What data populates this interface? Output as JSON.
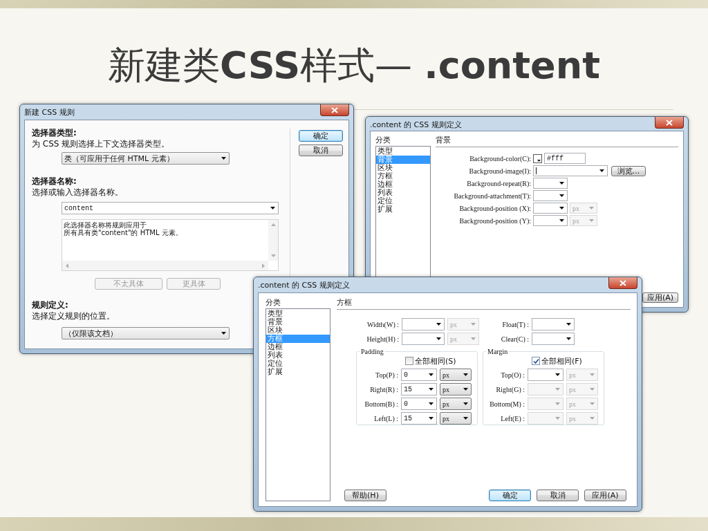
{
  "slide_title": "新建类**CSS**样式— **.content**",
  "new_rule_dialog": {
    "title": "新建 CSS 规则",
    "selector_type": {
      "heading": "选择器类型:",
      "description": "为 CSS 规则选择上下文选择器类型。",
      "value": "类（可应用于任何 HTML 元素）"
    },
    "selector_name": {
      "heading": "选择器名称:",
      "description": "选择或输入选择器名称。",
      "value": "content",
      "info": [
        "此选择器名称将规则应用于",
        "所有具有类\"content\"的 HTML 元素。"
      ]
    },
    "specificity_buttons": [
      {
        "label": "不太具体",
        "disabled": true
      },
      {
        "label": "更具体",
        "disabled": true
      }
    ],
    "rule_definition": {
      "heading": "规则定义:",
      "description": "选择定义规则的位置。",
      "value": "（仅限该文档）"
    },
    "buttons": [
      {
        "label": "确定",
        "focused": true
      },
      {
        "label": "取消",
        "focused": false
      }
    ]
  },
  "background_dialog": {
    "title": ".content 的 CSS 规则定义",
    "category_label": "分类",
    "categories": [
      {
        "label": "类型",
        "selected": false
      },
      {
        "label": "背景",
        "selected": true
      },
      {
        "label": "区块",
        "selected": false
      },
      {
        "label": "方框",
        "selected": false
      },
      {
        "label": "边框",
        "selected": false
      },
      {
        "label": "列表",
        "selected": false
      },
      {
        "label": "定位",
        "selected": false
      },
      {
        "label": "扩展",
        "selected": false
      }
    ],
    "section": "背景",
    "fields": [
      {
        "kind": "color",
        "label": "Background-color(C):",
        "value": "#fff"
      },
      {
        "kind": "image",
        "label": "Background-image(I):",
        "button": "浏览..."
      },
      {
        "kind": "select",
        "label": "Background-repeat(R):"
      },
      {
        "kind": "select",
        "label": "Background-attachment(T):"
      },
      {
        "kind": "select_unit",
        "label": "Background-position (X):",
        "unit": "px",
        "unit_disabled": true
      },
      {
        "kind": "select_unit",
        "label": "Background-position (Y):",
        "unit": "px",
        "unit_disabled": true
      }
    ],
    "apply_button": "应用(A)"
  },
  "box_dialog": {
    "title": ".content 的 CSS 规则定义",
    "category_label": "分类",
    "categories": [
      {
        "label": "类型",
        "selected": false
      },
      {
        "label": "背景",
        "selected": false
      },
      {
        "label": "区块",
        "selected": false
      },
      {
        "label": "方框",
        "selected": true
      },
      {
        "label": "边框",
        "selected": false
      },
      {
        "label": "列表",
        "selected": false
      },
      {
        "label": "定位",
        "selected": false
      },
      {
        "label": "扩展",
        "selected": false
      }
    ],
    "section": "方框",
    "size_fields": [
      {
        "label": "Width(W) :",
        "unit": "px",
        "unit_disabled": true
      },
      {
        "label": "Height(H) :",
        "unit": "px",
        "unit_disabled": true
      }
    ],
    "layout_fields": [
      {
        "label": "Float(T) :"
      },
      {
        "label": "Clear(C) :"
      }
    ],
    "groups": [
      {
        "legend": "Padding",
        "same_all": {
          "label": "全部相同(S)",
          "checked": false
        },
        "rows": [
          {
            "label": "Top(P) :",
            "value": "0",
            "unit": "px",
            "disabled": false,
            "unit_disabled": false
          },
          {
            "label": "Right(R) :",
            "value": "15",
            "unit": "px",
            "disabled": false,
            "unit_disabled": false
          },
          {
            "label": "Bottom(B) :",
            "value": "0",
            "unit": "px",
            "disabled": false,
            "unit_disabled": false
          },
          {
            "label": "Left(L) :",
            "value": "15",
            "unit": "px",
            "disabled": false,
            "unit_disabled": false
          }
        ]
      },
      {
        "legend": "Margin",
        "same_all": {
          "label": "全部相同(F)",
          "checked": true
        },
        "rows": [
          {
            "label": "Top(O) :",
            "unit": "px",
            "disabled": false,
            "unit_disabled": true
          },
          {
            "label": "Right(G) :",
            "unit": "px",
            "disabled": true,
            "unit_disabled": true
          },
          {
            "label": "Bottom(M) :",
            "unit": "px",
            "disabled": true,
            "unit_disabled": true
          },
          {
            "label": "Left(E) :",
            "unit": "px",
            "disabled": true,
            "unit_disabled": true
          }
        ]
      }
    ],
    "help_button": "帮助(H)",
    "buttons": [
      {
        "label": "确定",
        "focused": true
      },
      {
        "label": "取消",
        "focused": false
      },
      {
        "label": "应用(A)",
        "focused": false
      }
    ]
  }
}
